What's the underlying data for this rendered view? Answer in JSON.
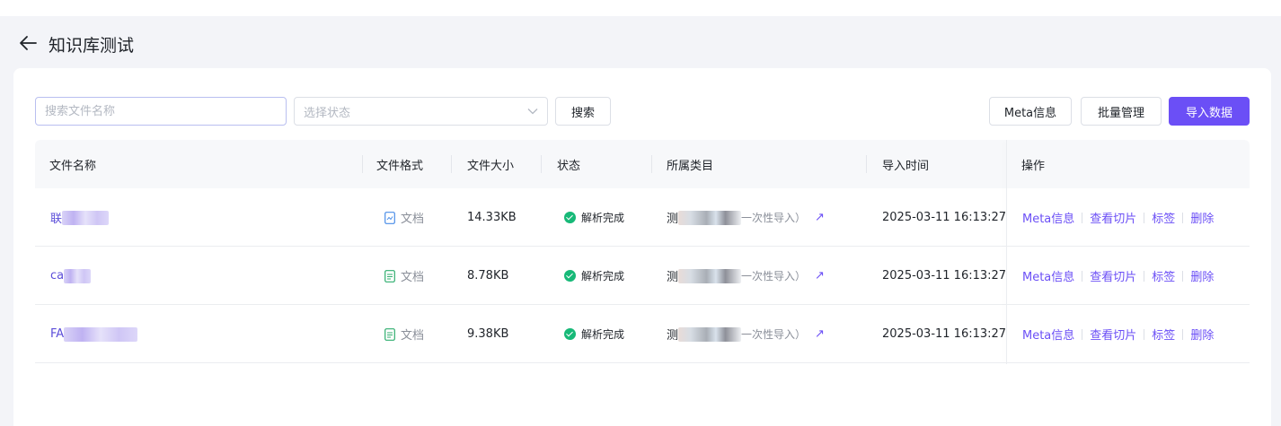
{
  "header": {
    "title": "知识库测试"
  },
  "toolbar": {
    "search_placeholder": "搜索文件名称",
    "search_value": "",
    "status_placeholder": "选择状态",
    "search_button": "搜索",
    "meta_button": "Meta信息",
    "batch_button": "批量管理",
    "import_button": "导入数据"
  },
  "table": {
    "columns": {
      "name": "文件名称",
      "format": "文件格式",
      "size": "文件大小",
      "status": "状态",
      "category": "所属类目",
      "import_time": "导入时间",
      "actions": "操作"
    },
    "rows": [
      {
        "name_prefix": "联",
        "format": "文档",
        "format_icon": "doc-image-icon",
        "size": "14.33KB",
        "status": "解析完成",
        "category_prefix": "测",
        "category_suffix": "一次性导入）",
        "import_time": "2025-03-11 16:13:27",
        "actions": [
          "Meta信息",
          "查看切片",
          "标签",
          "删除"
        ]
      },
      {
        "name_prefix": "ca",
        "format": "文档",
        "format_icon": "doc-text-icon",
        "size": "8.78KB",
        "status": "解析完成",
        "category_prefix": "测",
        "category_suffix": "一次性导入）",
        "import_time": "2025-03-11 16:13:27",
        "actions": [
          "Meta信息",
          "查看切片",
          "标签",
          "删除"
        ]
      },
      {
        "name_prefix": "FA",
        "format": "文档",
        "format_icon": "doc-text-icon",
        "size": "9.38KB",
        "status": "解析完成",
        "category_prefix": "测",
        "category_suffix": "一次性导入）",
        "import_time": "2025-03-11 16:13:27",
        "actions": [
          "Meta信息",
          "查看切片",
          "标签",
          "删除"
        ]
      }
    ]
  },
  "colors": {
    "accent": "#6b4ff6",
    "success": "#17b978",
    "background": "#f3f4f8"
  }
}
